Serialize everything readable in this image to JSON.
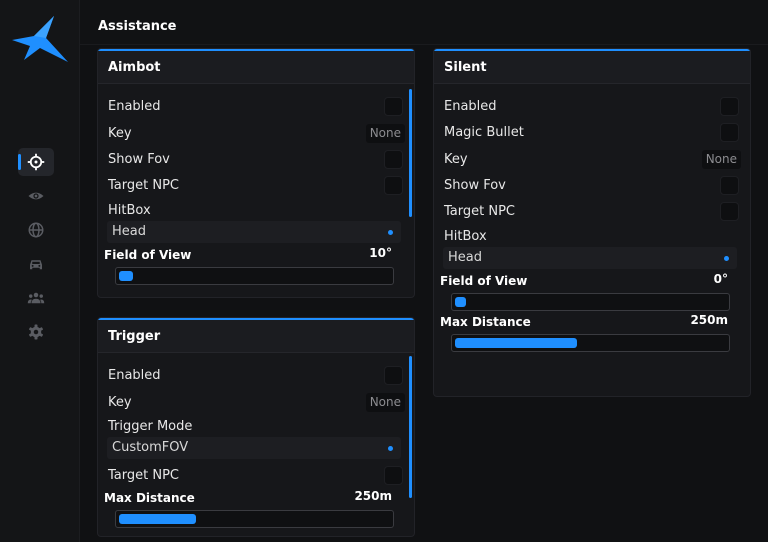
{
  "page": {
    "title": "Assistance"
  },
  "colors": {
    "accent": "#1f8fff",
    "background": "#101113",
    "panel": "#16171a"
  },
  "sidebar": {
    "items": [
      {
        "icon": "crosshair-icon",
        "active": true
      },
      {
        "icon": "eye-icon",
        "active": false
      },
      {
        "icon": "globe-icon",
        "active": false
      },
      {
        "icon": "car-icon",
        "active": false
      },
      {
        "icon": "users-icon",
        "active": false
      },
      {
        "icon": "gear-icon",
        "active": false
      }
    ]
  },
  "aimbot": {
    "title": "Aimbot",
    "enabled_label": "Enabled",
    "key_label": "Key",
    "key_value": "None",
    "show_fov_label": "Show Fov",
    "target_npc_label": "Target NPC",
    "hitbox_label": "HitBox",
    "hitbox_value": "Head",
    "fov_label": "Field of View",
    "fov_value": "10°",
    "fov_fraction": 0.06
  },
  "trigger": {
    "title": "Trigger",
    "enabled_label": "Enabled",
    "key_label": "Key",
    "key_value": "None",
    "mode_label": "Trigger Mode",
    "mode_value": "CustomFOV",
    "target_npc_label": "Target NPC",
    "distance_label": "Max Distance",
    "distance_value": "250m",
    "distance_fraction": 0.29
  },
  "silent": {
    "title": "Silent",
    "enabled_label": "Enabled",
    "magic_bullet_label": "Magic Bullet",
    "key_label": "Key",
    "key_value": "None",
    "show_fov_label": "Show Fov",
    "target_npc_label": "Target NPC",
    "hitbox_label": "HitBox",
    "hitbox_value": "Head",
    "fov_label": "Field of View",
    "fov_value": "0°",
    "fov_fraction": 0.05,
    "distance_label": "Max Distance",
    "distance_value": "250m",
    "distance_fraction": 0.45
  }
}
